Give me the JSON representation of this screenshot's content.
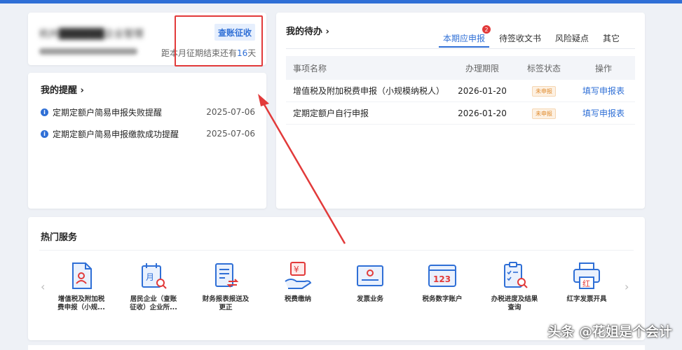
{
  "company": {
    "name_blurred": "杭州██████企业管理",
    "tax_type": "查账征收",
    "deadline_prefix": "距本月征期结束还有",
    "deadline_days": "16",
    "deadline_suffix": "天"
  },
  "reminders": {
    "title": "我的提醒",
    "chevron": "›",
    "items": [
      {
        "text": "定期定额户简易申报失败提醒",
        "date": "2025-07-06"
      },
      {
        "text": "定期定额户简易申报缴款成功提醒",
        "date": "2025-07-06"
      }
    ]
  },
  "todo": {
    "title": "我的待办",
    "chevron": "›",
    "tabs": [
      {
        "label": "本期应申报",
        "badge": "2"
      },
      {
        "label": "待签收文书"
      },
      {
        "label": "风险疑点"
      },
      {
        "label": "其它"
      }
    ],
    "columns": [
      "事项名称",
      "办理期限",
      "标签状态",
      "操作"
    ],
    "rows": [
      {
        "name": "增值税及附加税费申报（小规模纳税人）",
        "deadline": "2026-01-20",
        "status": "未申报",
        "action": "填写申报表"
      },
      {
        "name": "定期定额户自行申报",
        "deadline": "2026-01-20",
        "status": "未申报",
        "action": "填写申报表"
      }
    ]
  },
  "services": {
    "title": "热门服务",
    "prev": "‹",
    "next": "›",
    "items": [
      {
        "label_line1": "增值税及附加税",
        "label_line2": "费申报（小规...",
        "icon": "person-doc-icon"
      },
      {
        "label_line1": "居民企业（查账",
        "label_line2": "征收）企业所...",
        "icon": "calendar-search-icon"
      },
      {
        "label_line1": "财务报表报送及",
        "label_line2": "更正",
        "icon": "report-exchange-icon"
      },
      {
        "label_line1": "税费缴纳",
        "label_line2": "",
        "icon": "yuan-hand-icon"
      },
      {
        "label_line1": "发票业务",
        "label_line2": "",
        "icon": "invoice-icon"
      },
      {
        "label_line1": "税务数字账户",
        "label_line2": "",
        "icon": "digital-account-icon"
      },
      {
        "label_line1": "办税进度及结果",
        "label_line2": "查询",
        "icon": "progress-search-icon"
      },
      {
        "label_line1": "红字发票开具",
        "label_line2": "",
        "icon": "red-invoice-printer-icon"
      }
    ]
  },
  "colors": {
    "accent": "#2f6fd6",
    "annotation": "#e23a3a"
  },
  "watermark": "头条 @花姐是个会计"
}
